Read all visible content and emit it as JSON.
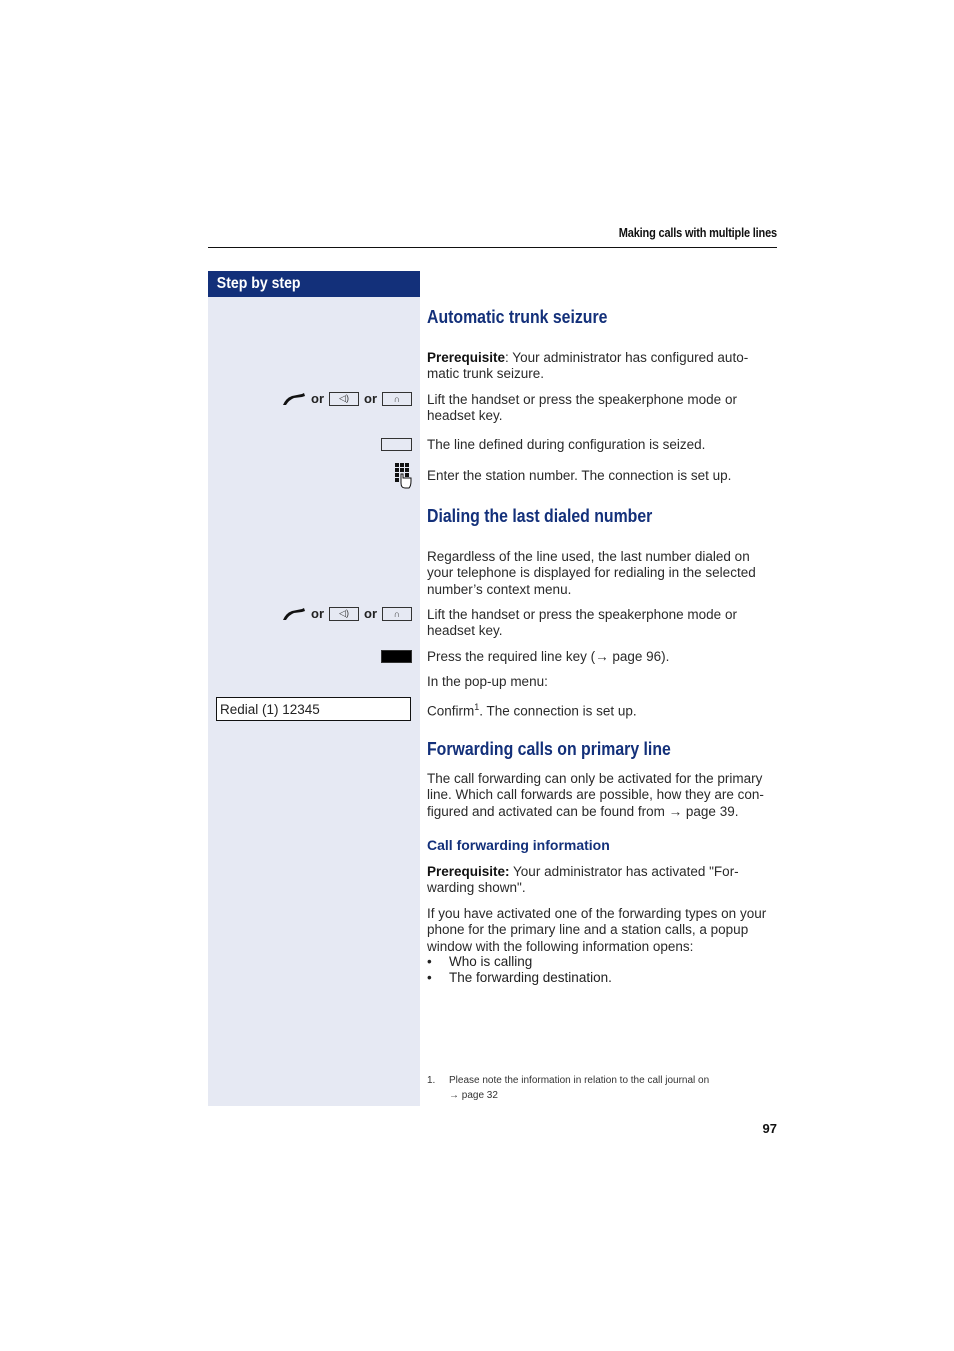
{
  "header": {
    "section_title": "Making calls with multiple lines"
  },
  "sidebar": {
    "heading": "Step by step",
    "redial_display": "Redial (1) 12345"
  },
  "icons": {
    "or_label": "or",
    "handset": "handset-lift-icon",
    "speaker": "speaker-key-icon",
    "headset": "headset-key-icon",
    "line_key": "line-key-icon",
    "line_key_pressed": "line-key-pressed-icon",
    "keypad": "keypad-icon",
    "speaker_glyph": "◁)",
    "headset_glyph": "∩"
  },
  "sections": {
    "auto_trunk": {
      "title": "Automatic trunk seizure",
      "prereq_label": "Prerequisite",
      "prereq_text": ": Your administrator has configured auto-matic trunk seizure.",
      "step1": "Lift the handset or press the speakerphone mode or headset key.",
      "step2": "The line defined during configuration is seized.",
      "step3": "Enter the station number. The connection is set up."
    },
    "last_dialed": {
      "title": "Dialing the last dialed number",
      "intro": "Regardless of the line used, the last number dialed on your telephone is displayed for redialing in the selected number’s context menu.",
      "step1": "Lift the handset or press the speakerphone mode or headset key.",
      "step2": "Press the required line key (→ page 96).",
      "step3": "In the pop-up menu:",
      "step4_text": "Confirm",
      "step4_sup": "1",
      "step4_rest": ". The connection is set up."
    },
    "forwarding": {
      "title": "Forwarding calls on primary line",
      "intro": "The call forwarding can only be activated for the primary line. Which call forwards are possible, how they are con-figured and activated can be found from → page 39.",
      "subtitle": "Call forwarding information",
      "prereq_label": "Prerequisite:",
      "prereq_text": " Your administrator has activated \"For-warding shown\".",
      "body": "If you have activated one of the forwarding types on your phone for the primary line and a station calls, a popup window with the following information opens:",
      "bullets": [
        "Who is calling",
        "The forwarding destination."
      ]
    }
  },
  "footnote": {
    "number": "1.",
    "text": "Please note the information in relation to the call journal on",
    "link": "→ page 32"
  },
  "page_number": "97"
}
